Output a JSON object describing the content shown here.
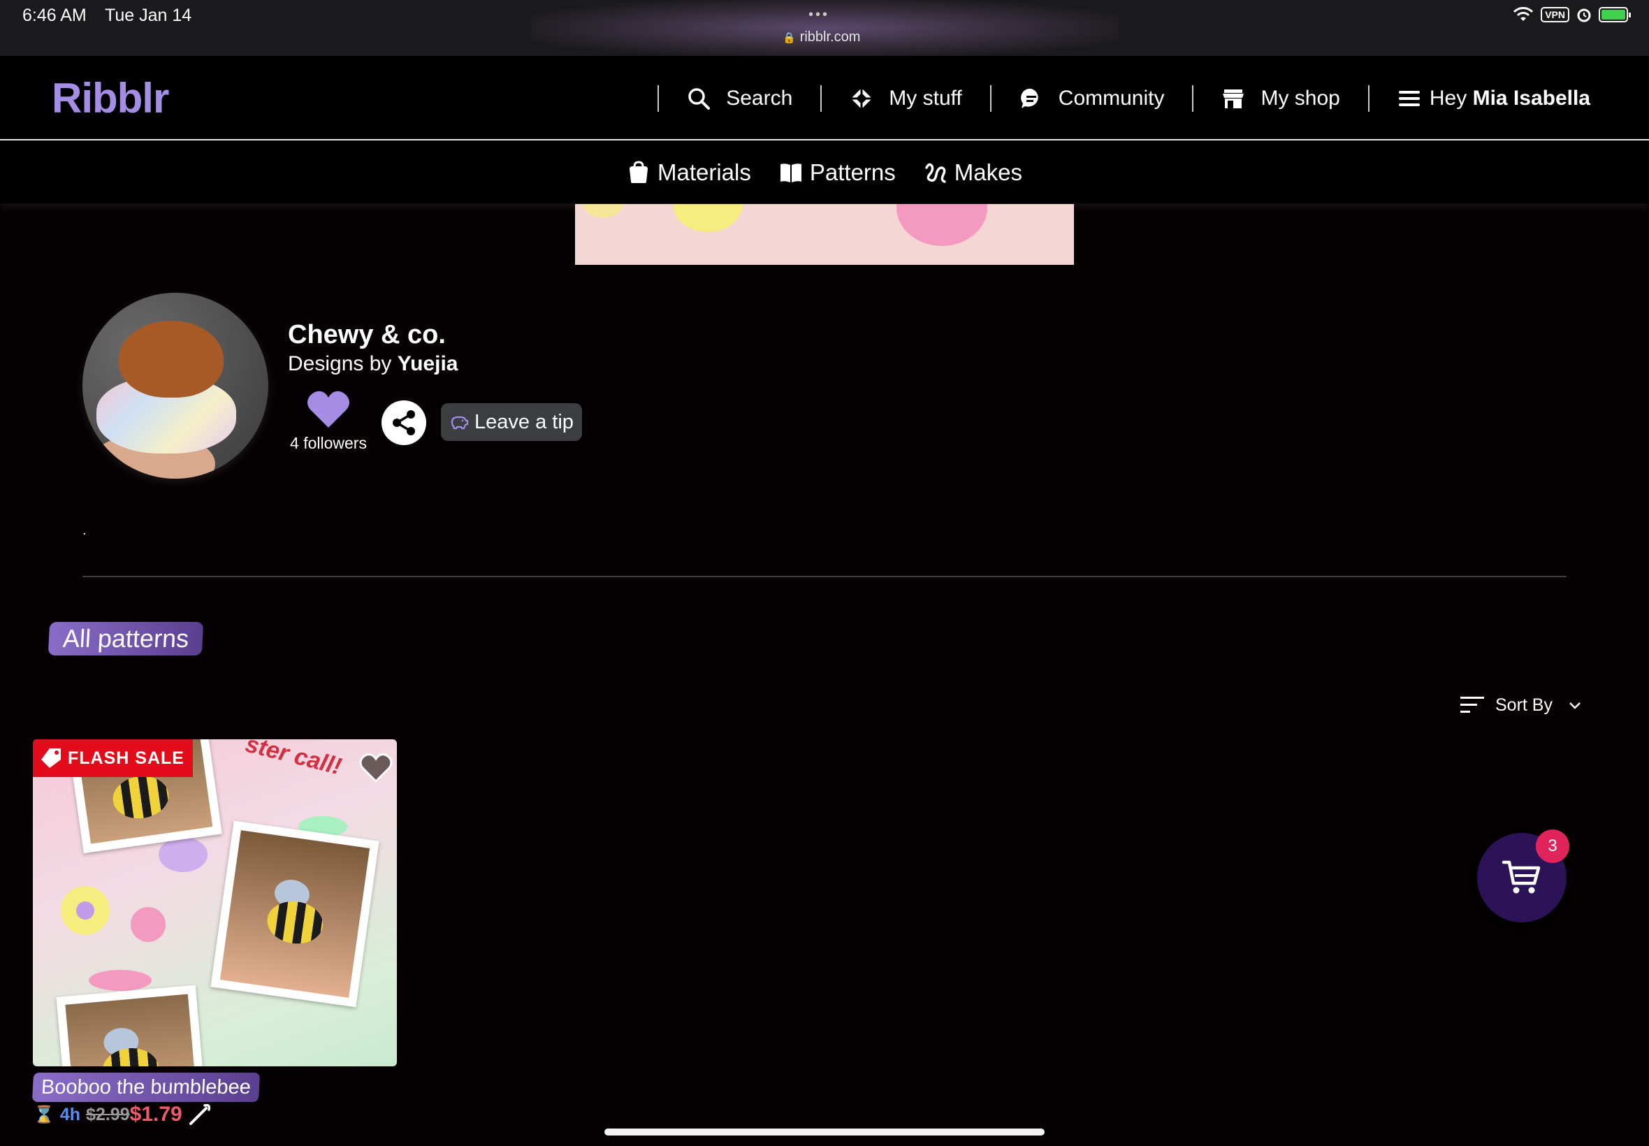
{
  "status_bar": {
    "time": "6:46 AM",
    "date": "Tue Jan 14",
    "url": "ribblr.com",
    "vpn_label": "VPN",
    "dots": "•••"
  },
  "header": {
    "logo": "Ribblr",
    "nav": [
      {
        "label": "Search",
        "icon": "search-icon"
      },
      {
        "label": "My stuff",
        "icon": "diamond-grid-icon"
      },
      {
        "label": "Community",
        "icon": "chat-bubble-icon"
      },
      {
        "label": "My shop",
        "icon": "store-icon"
      }
    ],
    "menu": {
      "prefix": "Hey",
      "user_name": "Mia Isabella",
      "icon": "hamburger-icon"
    }
  },
  "subnav": [
    {
      "label": "Materials",
      "icon": "bag-icon"
    },
    {
      "label": "Patterns",
      "icon": "book-icon"
    },
    {
      "label": "Makes",
      "icon": "yarn-squiggle-icon"
    }
  ],
  "profile": {
    "shop_name": "Chewy & co.",
    "designs_by_prefix": "Designs by",
    "designer": "Yuejia",
    "followers": "4 followers",
    "tip_label": "Leave a tip",
    "bio": "."
  },
  "patterns_section": {
    "tab_label": "All patterns",
    "sort_label": "Sort By"
  },
  "products": [
    {
      "title": "Booboo the bumblebee",
      "badge": "FLASH SALE",
      "image_script_text": "ster call!",
      "time_left": "4h",
      "old_price": "$2.99",
      "new_price": "$1.79"
    }
  ],
  "cart": {
    "count": "3"
  },
  "colors": {
    "brand": "#a58de6",
    "flash_sale": "#e20c1a",
    "sale_price": "#ef5a6a",
    "cart_bg": "#2c1357",
    "cart_badge": "#e2245d"
  }
}
